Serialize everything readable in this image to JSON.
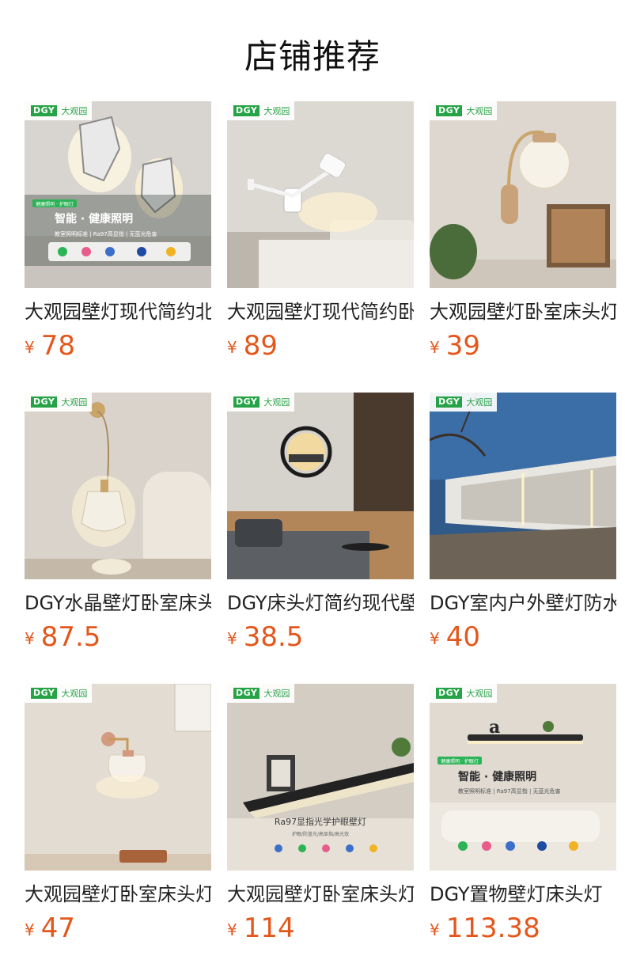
{
  "section_title": "店铺推荐",
  "brand": {
    "mark": "DGY",
    "name": "大观园"
  },
  "products": [
    {
      "name": "大观园壁灯现代简约北欧",
      "currency": "¥",
      "price": "78",
      "image_icon": "stone-wall-lamp-icon",
      "image_text": [
        "智能 · 健康照明",
        "教室照明标准 | Ra97高显指 | 无蓝光危害"
      ]
    },
    {
      "name": "大观园壁灯现代简约卧室",
      "currency": "¥",
      "price": "89",
      "image_icon": "swing-arm-lamp-icon",
      "image_text": []
    },
    {
      "name": "大观园壁灯卧室床头灯",
      "currency": "¥",
      "price": "39",
      "image_icon": "globe-wall-lamp-icon",
      "image_text": []
    },
    {
      "name": "DGY水晶壁灯卧室床头灯",
      "currency": "¥",
      "price": "87.5",
      "image_icon": "crystal-pendant-lamp-icon",
      "image_text": []
    },
    {
      "name": "DGY床头灯简约现代壁灯",
      "currency": "¥",
      "price": "38.5",
      "image_icon": "deer-ring-lamp-icon",
      "image_text": []
    },
    {
      "name": "DGY室内户外壁灯防水",
      "currency": "¥",
      "price": "40",
      "image_icon": "outdoor-line-lamp-icon",
      "image_text": []
    },
    {
      "name": "大观园壁灯卧室床头灯",
      "currency": "¥",
      "price": "47",
      "image_icon": "glass-shade-lamp-icon",
      "image_text": []
    },
    {
      "name": "大观园壁灯卧室床头灯",
      "currency": "¥",
      "price": "114",
      "image_icon": "shelf-line-lamp-icon",
      "image_text": [
        "Ra97显指光学护眼壁灯",
        "护眼/防蓝光/高显指/高光效"
      ]
    },
    {
      "name": "DGY置物壁灯床头灯",
      "currency": "¥",
      "price": "113.38",
      "image_icon": "shelf-wall-lamp-icon",
      "image_text": [
        "智能 · 健康照明",
        "教室照明标准 | Ra97高显指 | 无蓝光危害"
      ]
    }
  ]
}
